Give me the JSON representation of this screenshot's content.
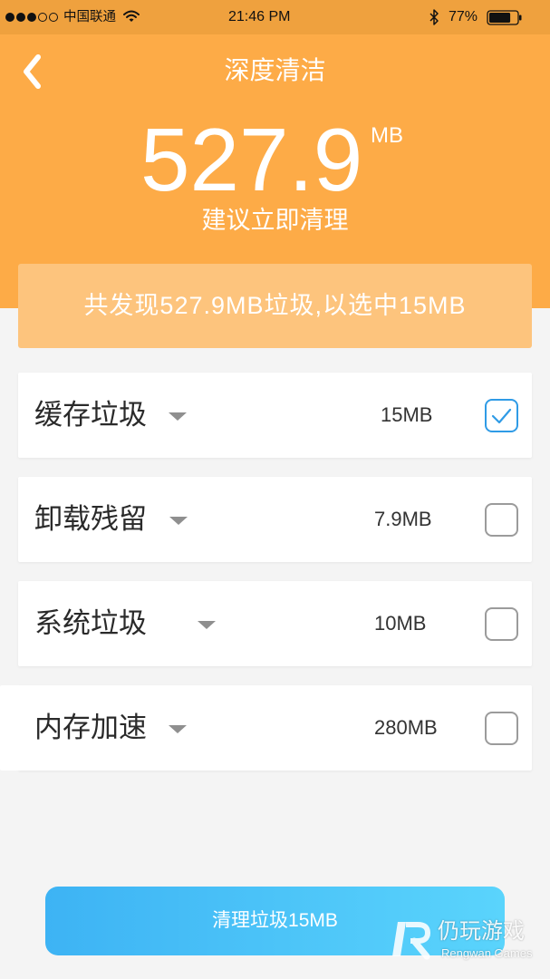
{
  "status_bar": {
    "signal_strength": 3,
    "signal_max": 5,
    "carrier": "中国联通",
    "time": "21:46 PM",
    "battery_text": "77%",
    "battery_level": 0.77,
    "icons": {
      "wifi": "wifi-icon",
      "bluetooth": "bluetooth-icon",
      "battery": "battery-icon"
    }
  },
  "header": {
    "back_icon": "chevron-left-icon",
    "title": "深度清洁",
    "total_size": "527.9",
    "total_unit": "MB",
    "suggestion": "建议立即清理"
  },
  "summary": {
    "text": "共发现527.9MB垃圾,以选中15MB"
  },
  "items": [
    {
      "label": "缓存垃圾",
      "size": "15MB",
      "checked": true,
      "expand_icon": "caret-down-icon"
    },
    {
      "label": "卸载残留",
      "size": "7.9MB",
      "checked": false,
      "expand_icon": "caret-down-icon"
    },
    {
      "label": "系统垃圾",
      "size": "10MB",
      "checked": false,
      "expand_icon": "caret-down-icon"
    },
    {
      "label": "内存加速",
      "size": "280MB",
      "checked": false,
      "expand_icon": "caret-down-icon"
    }
  ],
  "action": {
    "clean_label": "清理垃圾15MB"
  },
  "watermark": {
    "name": "仍玩游戏",
    "subtitle": "Rengwan Games",
    "icon": "rengwan-logo-icon"
  },
  "colors": {
    "status_bar": "#EFA13E",
    "header": "#FDAB47",
    "banner": "#FDC47D",
    "background": "#F4F4F4",
    "button_start": "#3DB3F4",
    "button_end": "#5AD4FC",
    "checked": "#2F9BE6"
  }
}
